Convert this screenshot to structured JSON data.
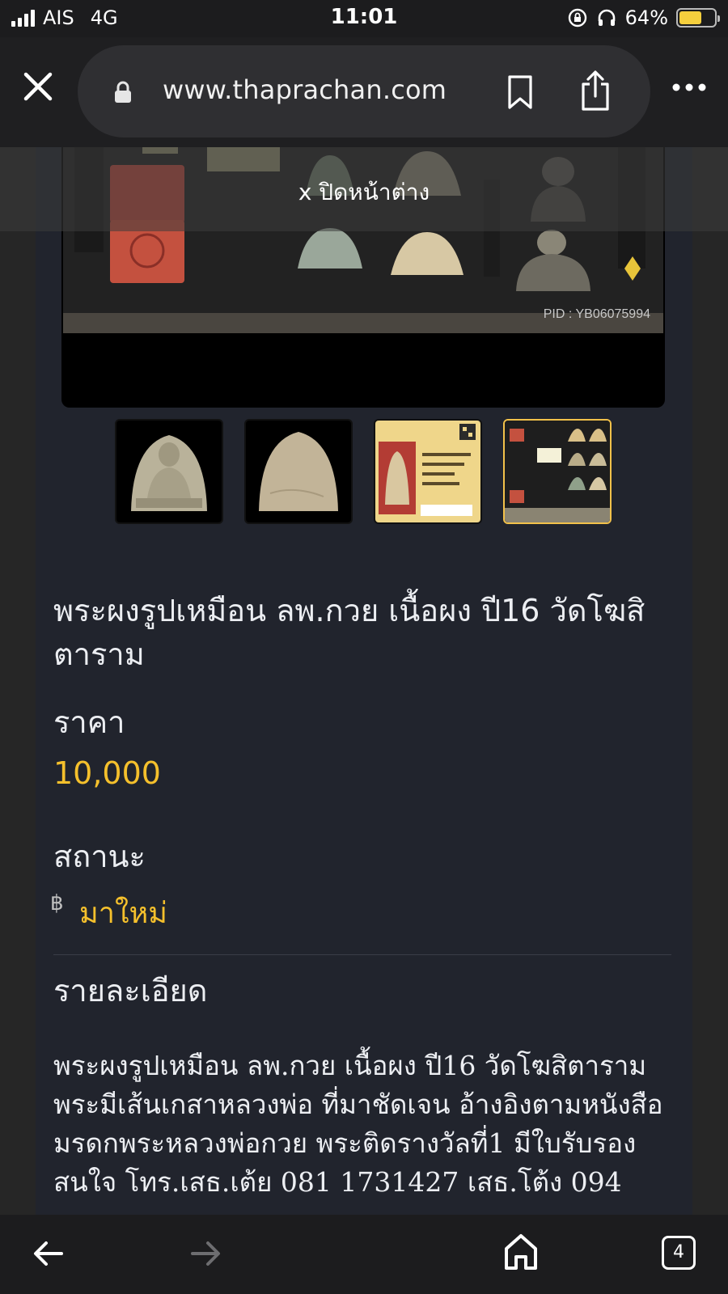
{
  "status_bar": {
    "carrier": "AIS",
    "network": "4G",
    "time": "11:01",
    "battery": "64%",
    "battery_level": 0.64
  },
  "browser": {
    "url": "www.thaprachan.com",
    "icons": [
      "close-icon",
      "lock-icon",
      "bookmark-icon",
      "share-icon",
      "more-icon"
    ]
  },
  "overlay": {
    "close_window": "x ปิดหน้าต่าง"
  },
  "gallery": {
    "pid": "PID : YB06075994",
    "thumbnails": [
      "thumbnail-front",
      "thumbnail-back",
      "thumbnail-certificate",
      "thumbnail-collection"
    ],
    "active_index": 3
  },
  "product": {
    "title": "พระผงรูปเหมือน ลพ.กวย เนื้อผง ปี16 วัดโฆสิตาราม",
    "price_label": "ราคา",
    "price": "10,000",
    "status_label": "สถานะ",
    "status_icon": "฿",
    "status": "มาใหม่",
    "details_label": "รายละเอียด",
    "details": "พระผงรูปเหมือน ลพ.กวย เนื้อผง ปี16 วัดโฆสิตาราม พระมีเส้นเกสาหลวงพ่อ ที่มาชัดเจน อ้างอิงตามหนังสือ มรดกพระหลวงพ่อกวย พระติดรางวัลที่1 มีใบรับรอง สนใจ โทร.เสธ.เต้ย 081 1731427 เสธ.โต้ง 094"
  },
  "bottom_bar": {
    "tabs_count": "4",
    "icons": [
      "back-arrow-icon",
      "forward-arrow-icon",
      "home-icon",
      "tabs-icon"
    ]
  },
  "colors": {
    "accent": "#f5c02c",
    "card_bg": "#21242d",
    "page_bg": "#262626"
  }
}
